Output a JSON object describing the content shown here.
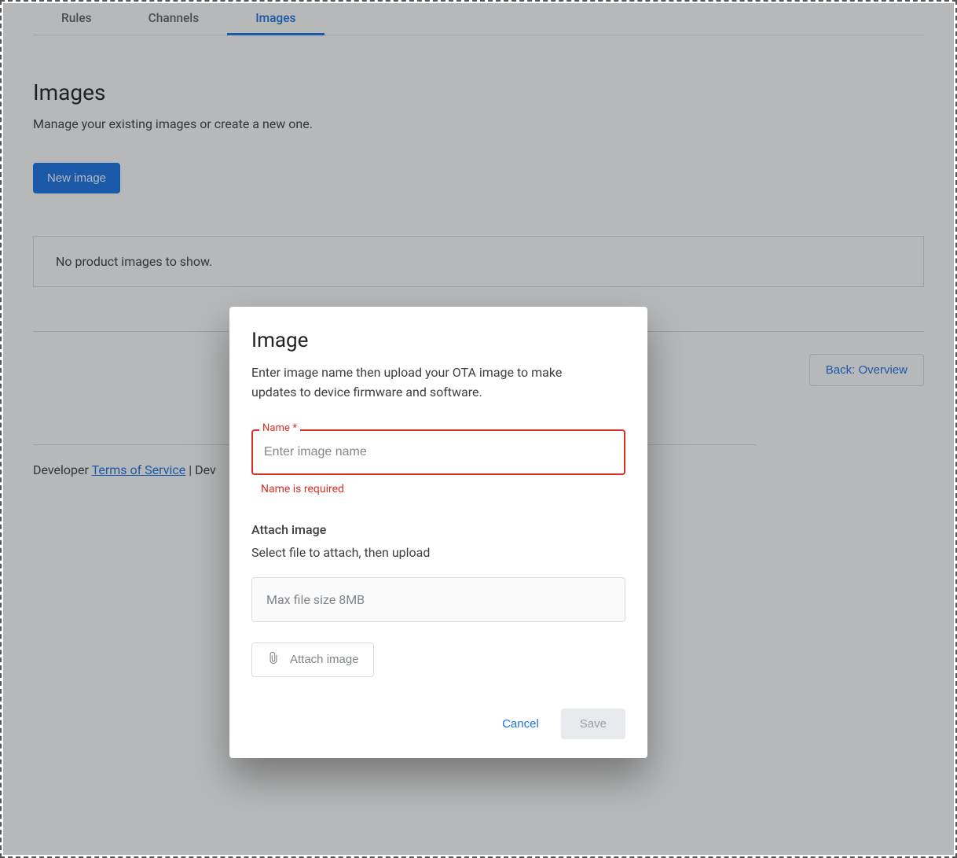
{
  "tabs": {
    "rules": "Rules",
    "channels": "Channels",
    "images": "Images"
  },
  "page": {
    "title": "Images",
    "subtitle": "Manage your existing images or create a new one.",
    "new_image_btn": "New image",
    "empty_message": "No product images to show.",
    "back_btn": "Back: Overview"
  },
  "footer": {
    "prefix": "Developer ",
    "tos": "Terms of Service",
    "sep": " | Dev"
  },
  "dialog": {
    "title": "Image",
    "description": "Enter image name then upload your OTA image to make updates to device firmware and software.",
    "name_label": "Name *",
    "name_placeholder": "Enter image name",
    "name_error": "Name is required",
    "attach_title": "Attach image",
    "attach_desc": "Select file to attach, then upload",
    "file_placeholder": "Max file size 8MB",
    "attach_btn": "Attach image",
    "cancel": "Cancel",
    "save": "Save"
  }
}
